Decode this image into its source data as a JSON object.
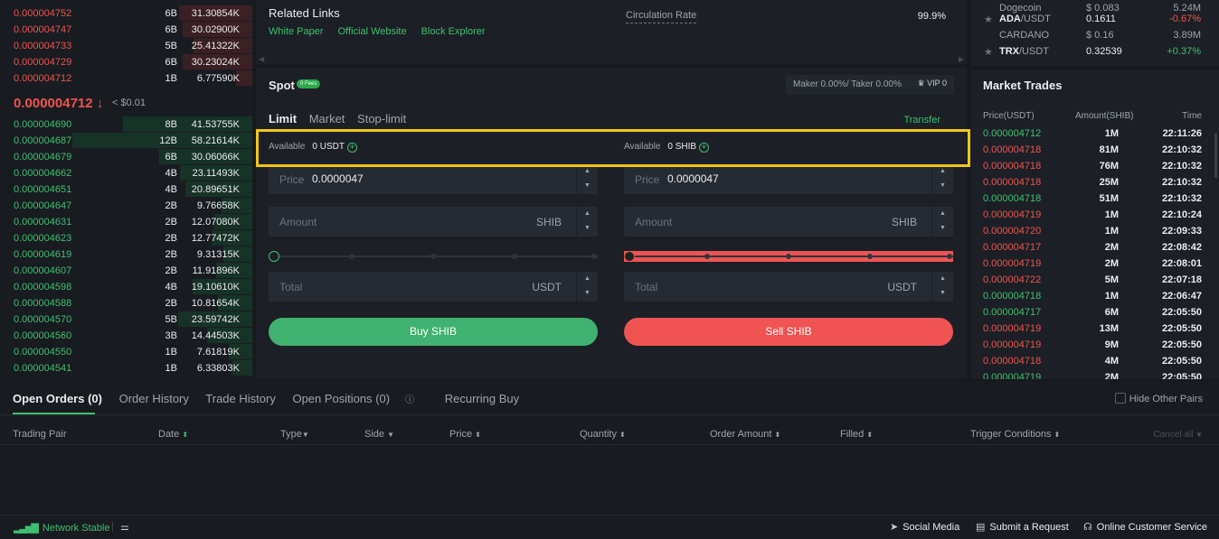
{
  "orderbook": {
    "asks": [
      {
        "price": "0.000004752",
        "count": "6B",
        "qty": "31.30854K",
        "depth": 0.55
      },
      {
        "price": "0.000004747",
        "count": "6B",
        "qty": "30.02900K",
        "depth": 0.52
      },
      {
        "price": "0.000004733",
        "count": "5B",
        "qty": "25.41322K",
        "depth": 0.44
      },
      {
        "price": "0.000004729",
        "count": "6B",
        "qty": "30.23024K",
        "depth": 0.52
      },
      {
        "price": "0.000004712",
        "count": "1B",
        "qty": "6.77590K",
        "depth": 0.12
      }
    ],
    "last_price": "0.000004712",
    "last_arrow": "↓",
    "last_usd": "< $0.01",
    "bids": [
      {
        "price": "0.000004690",
        "count": "8B",
        "qty": "41.53755K",
        "depth": 0.72
      },
      {
        "price": "0.000004687",
        "count": "12B",
        "qty": "58.21614K",
        "depth": 1.0
      },
      {
        "price": "0.000004679",
        "count": "6B",
        "qty": "30.06066K",
        "depth": 0.52
      },
      {
        "price": "0.000004662",
        "count": "4B",
        "qty": "23.11493K",
        "depth": 0.4
      },
      {
        "price": "0.000004651",
        "count": "4B",
        "qty": "20.89651K",
        "depth": 0.37
      },
      {
        "price": "0.000004647",
        "count": "2B",
        "qty": "9.76658K",
        "depth": 0.17
      },
      {
        "price": "0.000004631",
        "count": "2B",
        "qty": "12.07080K",
        "depth": 0.21
      },
      {
        "price": "0.000004623",
        "count": "2B",
        "qty": "12.77472K",
        "depth": 0.22
      },
      {
        "price": "0.000004619",
        "count": "2B",
        "qty": "9.31315K",
        "depth": 0.16
      },
      {
        "price": "0.000004607",
        "count": "2B",
        "qty": "11.91896K",
        "depth": 0.2
      },
      {
        "price": "0.000004598",
        "count": "4B",
        "qty": "19.10610K",
        "depth": 0.33
      },
      {
        "price": "0.000004588",
        "count": "2B",
        "qty": "10.81654K",
        "depth": 0.19
      },
      {
        "price": "0.000004570",
        "count": "5B",
        "qty": "23.59742K",
        "depth": 0.41
      },
      {
        "price": "0.000004560",
        "count": "3B",
        "qty": "14.44503K",
        "depth": 0.25
      },
      {
        "price": "0.000004550",
        "count": "1B",
        "qty": "7.61819K",
        "depth": 0.13
      },
      {
        "price": "0.000004541",
        "count": "1B",
        "qty": "6.33803K",
        "depth": 0.11
      }
    ]
  },
  "related": {
    "title": "Related Links",
    "links": [
      "White Paper",
      "Official Website",
      "Block Explorer"
    ],
    "circulation_label": "Circulation Rate",
    "circulation_value": "99.9%"
  },
  "spot": {
    "title": "Spot",
    "fees_badge": "0 Fees",
    "fee_text": "Maker 0.00%/ Taker 0.00%",
    "vip_label": "VIP 0",
    "tabs": [
      "Limit",
      "Market",
      "Stop-limit"
    ],
    "transfer": "Transfer",
    "buy": {
      "available_label": "Available",
      "available_value": "0 USDT",
      "price_label": "Price",
      "price_value": "0.0000047",
      "amount_label": "Amount",
      "amount_unit": "SHIB",
      "total_label": "Total",
      "total_unit": "USDT",
      "button": "Buy SHIB"
    },
    "sell": {
      "available_label": "Available",
      "available_value": "0 SHIB",
      "price_label": "Price",
      "price_value": "0.0000047",
      "amount_label": "Amount",
      "amount_unit": "SHIB",
      "total_label": "Total",
      "total_unit": "USDT",
      "button": "Sell SHIB"
    }
  },
  "markets": [
    {
      "pair_base": "ADA",
      "pair_quote": "/USDT",
      "name": "CARDANO",
      "price": "0.1611",
      "usd": "$ 0.16",
      "change": "-0.67%",
      "dir": "down",
      "volume": "3.89M"
    },
    {
      "pair_base": "TRX",
      "pair_quote": "/USDT",
      "name": "",
      "price": "0.32539",
      "usd": "",
      "change": "+0.37%",
      "dir": "up",
      "volume": ""
    }
  ],
  "markets_partial_top": {
    "name": "Dogecoin",
    "usd": "$ 0.083",
    "volume": "5.24M"
  },
  "trades": {
    "title": "Market Trades",
    "headers": [
      "Price(USDT)",
      "Amount(SHIB)",
      "Time"
    ],
    "rows": [
      {
        "price": "0.000004712",
        "amount": "1M",
        "time": "22:11:26",
        "dir": "up"
      },
      {
        "price": "0.000004718",
        "amount": "81M",
        "time": "22:10:32",
        "dir": "down"
      },
      {
        "price": "0.000004718",
        "amount": "76M",
        "time": "22:10:32",
        "dir": "down"
      },
      {
        "price": "0.000004718",
        "amount": "25M",
        "time": "22:10:32",
        "dir": "down"
      },
      {
        "price": "0.000004718",
        "amount": "51M",
        "time": "22:10:32",
        "dir": "up"
      },
      {
        "price": "0.000004719",
        "amount": "1M",
        "time": "22:10:24",
        "dir": "down"
      },
      {
        "price": "0.000004720",
        "amount": "1M",
        "time": "22:09:33",
        "dir": "down"
      },
      {
        "price": "0.000004717",
        "amount": "2M",
        "time": "22:08:42",
        "dir": "down"
      },
      {
        "price": "0.000004719",
        "amount": "2M",
        "time": "22:08:01",
        "dir": "down"
      },
      {
        "price": "0.000004722",
        "amount": "5M",
        "time": "22:07:18",
        "dir": "down"
      },
      {
        "price": "0.000004718",
        "amount": "1M",
        "time": "22:06:47",
        "dir": "up"
      },
      {
        "price": "0.000004717",
        "amount": "6M",
        "time": "22:05:50",
        "dir": "up"
      },
      {
        "price": "0.000004719",
        "amount": "13M",
        "time": "22:05:50",
        "dir": "down"
      },
      {
        "price": "0.000004719",
        "amount": "9M",
        "time": "22:05:50",
        "dir": "down"
      },
      {
        "price": "0.000004718",
        "amount": "4M",
        "time": "22:05:50",
        "dir": "down"
      },
      {
        "price": "0.000004719",
        "amount": "2M",
        "time": "22:05:50",
        "dir": "up"
      }
    ]
  },
  "orders": {
    "tabs": [
      "Open Orders (0)",
      "Order History",
      "Trade History",
      "Open Positions (0)",
      "Recurring Buy"
    ],
    "hide_other": "Hide Other Pairs",
    "columns": [
      "Trading Pair",
      "Date",
      "Type",
      "Side",
      "Price",
      "Quantity",
      "Order Amount",
      "Filled",
      "Trigger Conditions"
    ],
    "cancel_all": "Cancel all"
  },
  "footer": {
    "network": "Network Stable",
    "social": "Social Media",
    "request": "Submit a Request",
    "support": "Online Customer Service"
  },
  "colors": {
    "up": "#3fbf70",
    "down": "#f0524f",
    "highlight": "#f5c518"
  }
}
